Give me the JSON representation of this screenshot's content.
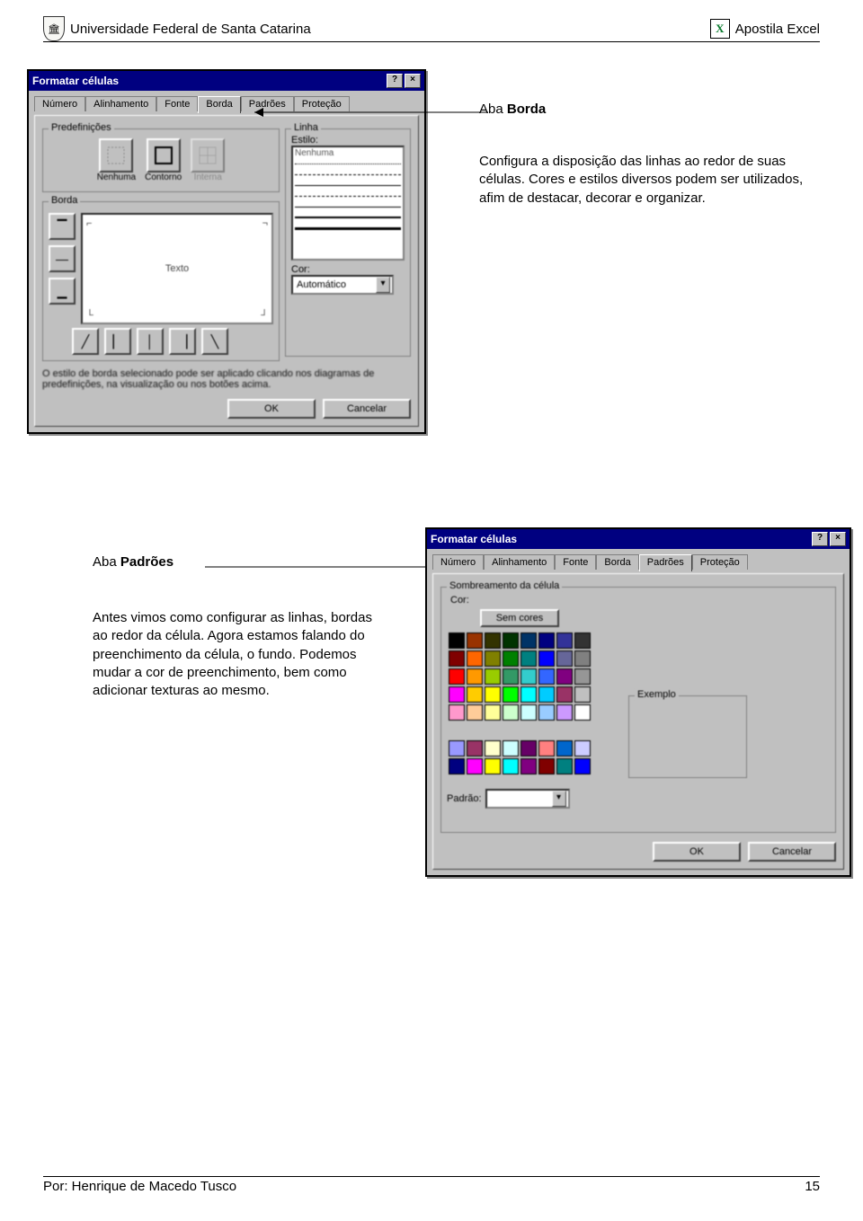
{
  "header": {
    "left": "Universidade Federal de Santa Catarina",
    "right": "Apostila Excel",
    "excel_icon": "X",
    "logo_glyph": "🏛"
  },
  "section1": {
    "heading_prefix": "Aba ",
    "heading_bold": "Borda",
    "body": "Configura a disposição das linhas ao redor de suas células. Cores e estilos diversos podem ser utilizados, afim de destacar, decorar e organizar."
  },
  "section2": {
    "heading_prefix": "Aba ",
    "heading_bold": "Padrões",
    "body": "Antes vimos como configurar as linhas, bordas ao redor da célula. Agora estamos falando do preenchimento da célula, o fundo. Podemos mudar a cor de preenchimento, bem como adicionar texturas ao mesmo."
  },
  "dialog1": {
    "title": "Formatar células",
    "tabs": [
      "Número",
      "Alinhamento",
      "Fonte",
      "Borda",
      "Padrões",
      "Proteção"
    ],
    "group_predef": "Predefinições",
    "predef_buttons": [
      "Nenhuma",
      "Contorno",
      "Interna"
    ],
    "group_border": "Borda",
    "group_line": "Linha",
    "style_label": "Estilo:",
    "style_none": "Nenhuma",
    "preview_text": "Texto",
    "color_label": "Cor:",
    "color_value": "Automático",
    "hint": "O estilo de borda selecionado pode ser aplicado clicando nos diagramas de predefinições, na visualização ou nos botões acima.",
    "ok": "OK",
    "cancel": "Cancelar"
  },
  "dialog2": {
    "title": "Formatar células",
    "tabs": [
      "Número",
      "Alinhamento",
      "Fonte",
      "Borda",
      "Padrões",
      "Proteção"
    ],
    "group_shade": "Sombreamento da célula",
    "color_label": "Cor:",
    "nocolor": "Sem cores",
    "pattern_label": "Padrão:",
    "sample_label": "Exemplo",
    "ok": "OK",
    "cancel": "Cancelar",
    "colors": [
      "#000000",
      "#993300",
      "#333300",
      "#003300",
      "#003366",
      "#000080",
      "#333399",
      "#333333",
      "#800000",
      "#ff6600",
      "#808000",
      "#008000",
      "#008080",
      "#0000ff",
      "#666699",
      "#808080",
      "#ff0000",
      "#ff9900",
      "#99cc00",
      "#339966",
      "#33cccc",
      "#3366ff",
      "#800080",
      "#969696",
      "#ff00ff",
      "#ffcc00",
      "#ffff00",
      "#00ff00",
      "#00ffff",
      "#00ccff",
      "#993366",
      "#c0c0c0",
      "#ff99cc",
      "#ffcc99",
      "#ffff99",
      "#ccffcc",
      "#ccffff",
      "#99ccff",
      "#cc99ff",
      "#ffffff",
      "#9999ff",
      "#993366",
      "#ffffcc",
      "#ccffff",
      "#660066",
      "#ff8080",
      "#0066cc",
      "#ccccff",
      "#000080",
      "#ff00ff",
      "#ffff00",
      "#00ffff",
      "#800080",
      "#800000",
      "#008080",
      "#0000ff"
    ]
  },
  "footer": {
    "left": "Por: Henrique de Macedo Tusco",
    "page": "15"
  }
}
